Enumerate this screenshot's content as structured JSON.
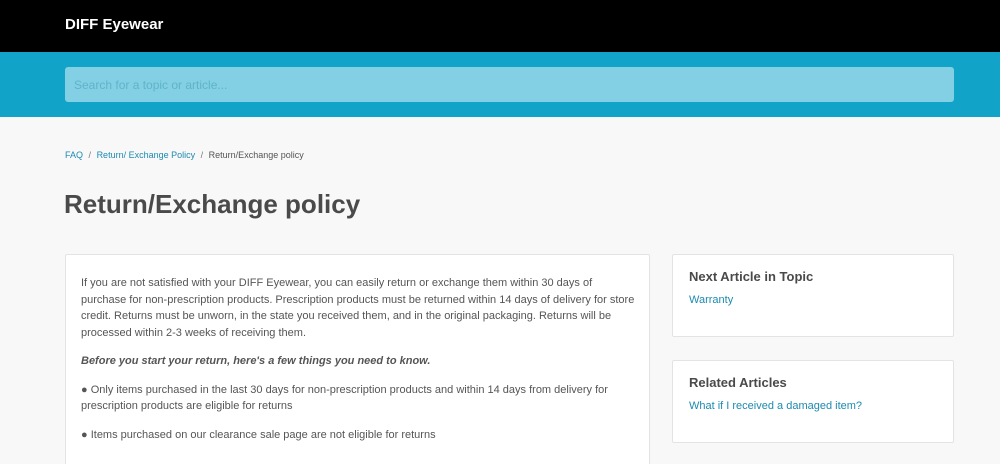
{
  "header": {
    "brand": "DIFF Eyewear"
  },
  "search": {
    "placeholder": "Search for a topic or article..."
  },
  "breadcrumb": [
    {
      "label": "FAQ"
    },
    {
      "label": "Return/ Exchange Policy"
    },
    {
      "label": "Return/Exchange policy"
    }
  ],
  "page": {
    "title": "Return/Exchange policy"
  },
  "article": {
    "intro": "If you are not satisfied with your DIFF Eyewear, you can easily return or exchange them within 30 days of purchase for non-prescription products. Prescription products must be returned within 14 days of delivery for store credit. Returns must be unworn, in the state you received them, and in the original packaging. Returns will be processed within 2-3 weeks of receiving them.",
    "emphasis": "Before you start your return, here's a few things you need to know.",
    "bullets": [
      "● Only items purchased in the last 30 days for non-prescription products and within 14 days from delivery for prescription products are eligible for returns",
      "● Items purchased on our clearance sale page are not eligible for returns"
    ]
  },
  "sidebar": {
    "next": {
      "heading": "Next Article in Topic",
      "link": "Warranty"
    },
    "related": {
      "heading": "Related Articles",
      "links": [
        "What if I received a damaged item?"
      ]
    }
  },
  "colors": {
    "topbar": "#000000",
    "search_band": "#11a3c8",
    "link": "#1d8ab0"
  }
}
